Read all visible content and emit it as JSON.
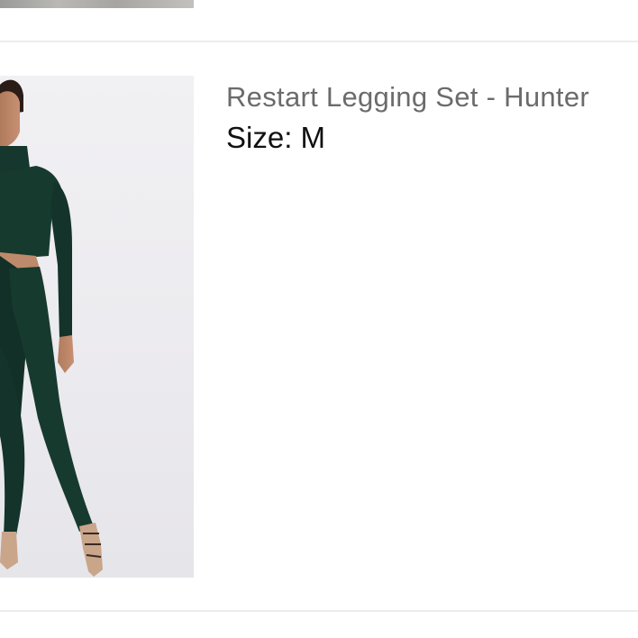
{
  "previous_item": {
    "image": "product-photo"
  },
  "cart_item": {
    "title": "Restart Legging Set - Hunter",
    "size_label": "Size:",
    "size_value": "M",
    "image": "product-photo",
    "colors": {
      "garment": "#16372d",
      "background": "#eeedf0",
      "title": "#6b6b6b",
      "text": "#111111",
      "divider": "#ececec"
    }
  }
}
